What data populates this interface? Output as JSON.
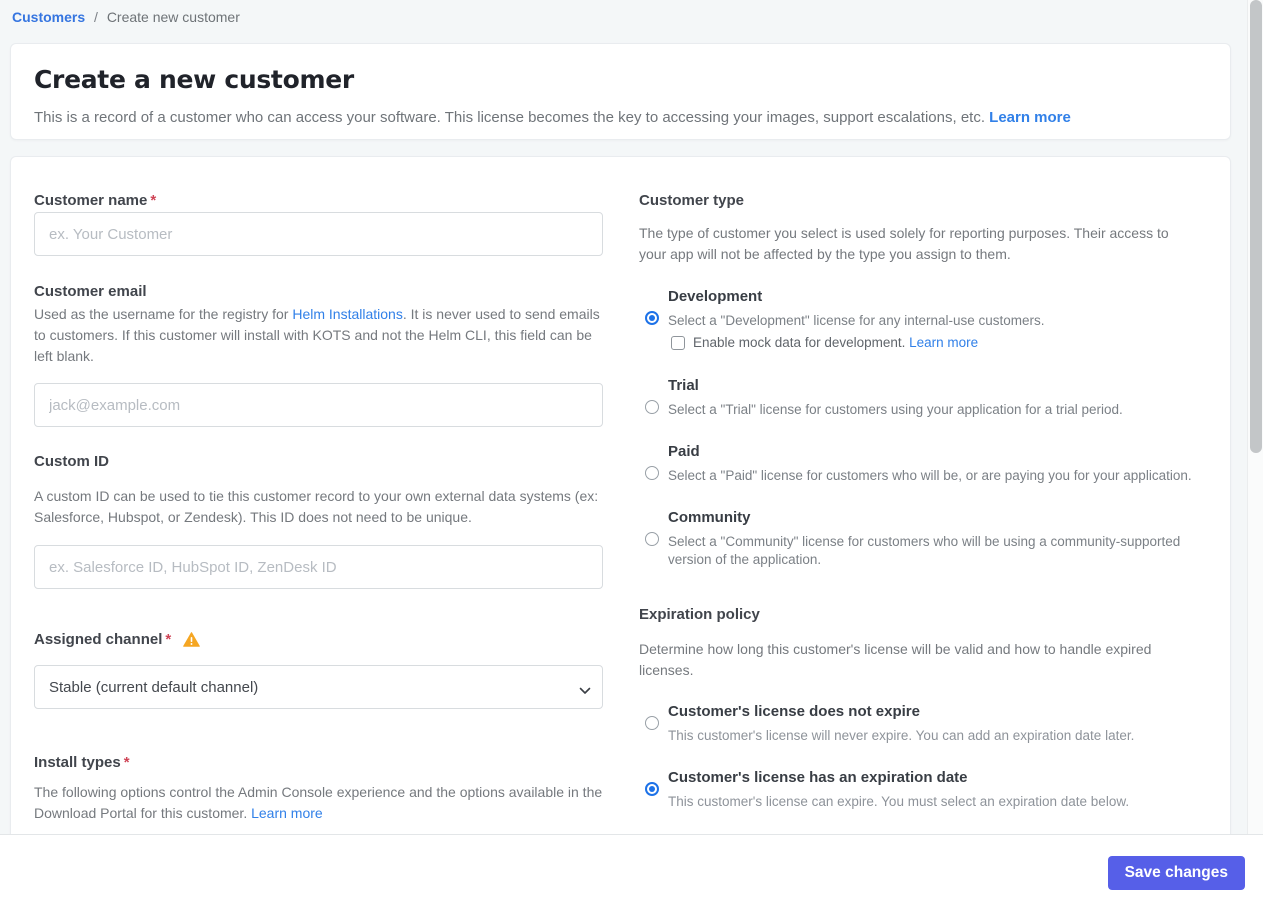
{
  "breadcrumb": {
    "customers": "Customers",
    "separator": "/",
    "current": "Create new customer"
  },
  "header": {
    "title": "Create a new customer",
    "description": "This is a record of a customer who can access your software. This license becomes the key to accessing your images, support escalations, etc.",
    "learn_more": "Learn more"
  },
  "form": {
    "customer_name": {
      "label": "Customer name",
      "required": "*",
      "placeholder": "ex. Your Customer",
      "value": ""
    },
    "customer_email": {
      "label": "Customer email",
      "description_before_link": "Used as the username for the registry for ",
      "link": "Helm Installations",
      "description_after_link": ". It is never used to send emails to customers. If this customer will install with KOTS and not the Helm CLI, this field can be left blank.",
      "placeholder": "jack@example.com",
      "value": ""
    },
    "custom_id": {
      "label": "Custom ID",
      "description": "A custom ID can be used to tie this customer record to your own external data systems (ex: Salesforce, Hubspot, or Zendesk). This ID does not need to be unique.",
      "placeholder": "ex. Salesforce ID, HubSpot ID, ZenDesk ID",
      "value": ""
    },
    "assigned_channel": {
      "label": "Assigned channel",
      "required": "*",
      "warning_icon": "warning-triangle",
      "selected_option": "Stable (current default channel)"
    },
    "install_types": {
      "label": "Install types",
      "required": "*",
      "description": "The following options control the Admin Console experience and the options available in the Download Portal for this customer.",
      "learn_more": "Learn more"
    }
  },
  "customer_type": {
    "heading": "Customer type",
    "description": "The type of customer you select is used solely for reporting purposes. Their access to your app will not be affected by the type you assign to them.",
    "options": [
      {
        "title": "Development",
        "description": "Select a \"Development\" license for any internal-use customers.",
        "selected": true,
        "checkbox": {
          "label": "Enable mock data for development.",
          "learn_more": "Learn more",
          "checked": false
        }
      },
      {
        "title": "Trial",
        "description": "Select a \"Trial\" license for customers using your application for a trial period.",
        "selected": false
      },
      {
        "title": "Paid",
        "description": "Select a \"Paid\" license for customers who will be, or are paying you for your application.",
        "selected": false
      },
      {
        "title": "Community",
        "description": "Select a \"Community\" license for customers who will be using a community-supported version of the application.",
        "selected": false
      }
    ]
  },
  "expiration_policy": {
    "heading": "Expiration policy",
    "description": "Determine how long this customer's license will be valid and how to handle expired licenses.",
    "options": [
      {
        "title": "Customer's license does not expire",
        "description": "This customer's license will never expire. You can add an expiration date later.",
        "selected": false
      },
      {
        "title": "Customer's license has an expiration date",
        "description": "This customer's license can expire. You must select an expiration date below.",
        "selected": true
      }
    ]
  },
  "footer": {
    "save_label": "Save changes"
  },
  "colors": {
    "accent_blue": "#1d72e8",
    "link_blue": "#3180e8",
    "breadcrumb_blue": "#3575e0",
    "button_indigo": "#565fe8",
    "warning_amber": "#f5a623",
    "required_red": "#cf4456",
    "page_background": "#f4f7f8"
  }
}
